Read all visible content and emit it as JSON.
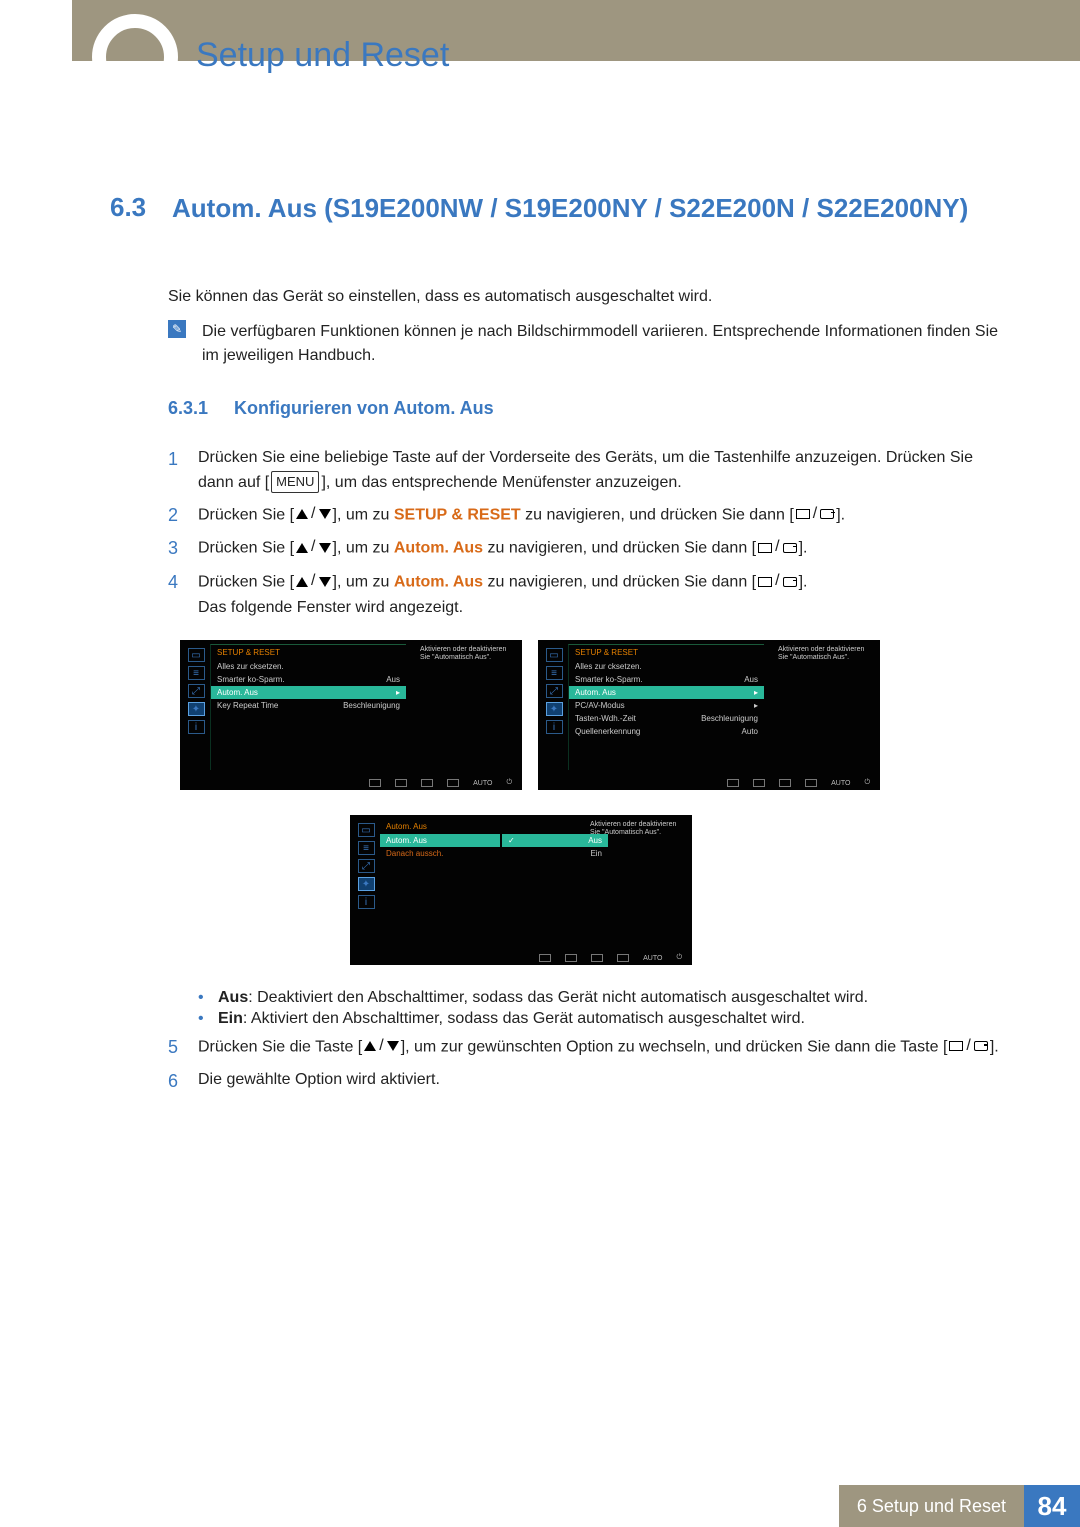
{
  "header": {
    "title": "Setup und Reset"
  },
  "section": {
    "num": "6.3",
    "title": "Autom. Aus (S19E200NW / S19E200NY / S22E200N / S22E200NY)"
  },
  "intro": "Sie können das Gerät so einstellen, dass es automatisch ausgeschaltet wird.",
  "note": "Die verfügbaren Funktionen können je nach Bildschirmmodell variieren. Entsprechende Informationen finden Sie im jeweiligen Handbuch.",
  "sub": {
    "num": "6.3.1",
    "title": "Konfigurieren von Autom. Aus"
  },
  "steps": {
    "s1a": "Drücken Sie eine beliebige Taste auf der Vorderseite des Geräts, um die Tastenhilfe anzuzeigen. Drücken Sie dann auf [",
    "s1_menu": "MENU",
    "s1b": "], um das entsprechende Menüfenster anzuzeigen.",
    "s2a": "Drücken Sie [",
    "s2b": "], um zu ",
    "s2_tgt": "SETUP & RESET",
    "s2c": " zu navigieren, und drücken Sie dann [",
    "s2d": "].",
    "s3a": "Drücken Sie [",
    "s3b": "], um zu ",
    "s3_tgt": "Autom. Aus",
    "s3c": " zu navigieren, und drücken Sie dann [",
    "s3d": "].",
    "s4a": "Drücken Sie [",
    "s4b": "], um zu ",
    "s4_tgt": "Autom. Aus",
    "s4c": " zu navigieren, und drücken Sie dann [",
    "s4d": "].",
    "s4e": "Das folgende Fenster wird angezeigt.",
    "s5a": "Drücken Sie die Taste [",
    "s5b": "], um zur gewünschten Option zu wechseln, und drücken Sie dann die Taste [",
    "s5c": "].",
    "s6": "Die gewählte Option wird aktiviert."
  },
  "bullets": {
    "aus_lbl": "Aus",
    "aus_txt": ": Deaktiviert den Abschalttimer, sodass das Gerät nicht automatisch ausgeschaltet wird.",
    "ein_lbl": "Ein",
    "ein_txt": ": Aktiviert den Abschalttimer, sodass das Gerät automatisch ausgeschaltet wird."
  },
  "osd": {
    "header": "SETUP & RESET",
    "desc": "Aktivieren oder deaktivieren Sie \"Automatisch Aus\".",
    "left": {
      "r1": "Alles zur cksetzen.",
      "r2": "Smarter  ko-Sparm.",
      "r2v": "Aus",
      "r3": "Autom. Aus",
      "r3v": "▸",
      "r4": "Key Repeat Time",
      "r4v": "Beschleunigung"
    },
    "right": {
      "r1": "Alles zur cksetzen.",
      "r2": "Smarter  ko-Sparm.",
      "r2v": "Aus",
      "r3": "Autom. Aus",
      "r3v": "▸",
      "r4": "PC/AV-Modus",
      "r4v": "▸",
      "r5": "Tasten-Wdh.-Zeit",
      "r5v": "Beschleunigung",
      "r6": "Quellenerkennung",
      "r6v": "Auto"
    },
    "sub": {
      "hd": "Autom. Aus",
      "r1": "Autom. Aus",
      "r1v": "Aus",
      "r2": "Danach aussch.",
      "opt1": "Aus",
      "opt2": "Ein"
    },
    "bottom_auto": "AUTO"
  },
  "footer": {
    "title": "6 Setup und Reset",
    "page": "84"
  }
}
